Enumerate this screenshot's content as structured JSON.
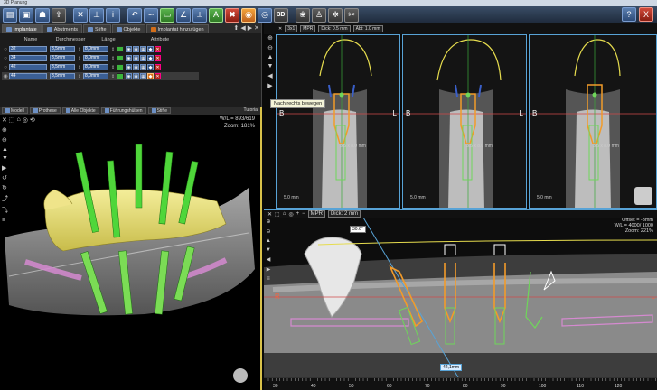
{
  "window": {
    "title": "3D Planung"
  },
  "toolbar": {
    "help": "?",
    "close": "X"
  },
  "left_panel": {
    "tabs": [
      {
        "label": "Implantate"
      },
      {
        "label": "Abutments"
      },
      {
        "label": "Stifte"
      },
      {
        "label": "Objekte"
      },
      {
        "label": "Implantat hinzufügen"
      }
    ],
    "columns": [
      "Name",
      "Durchmesser",
      "Länge",
      "Attribute"
    ],
    "rows": [
      {
        "name": "32",
        "diameter": "3,5mm",
        "length": "8,0mm",
        "color": "#3cb53c",
        "selected": false
      },
      {
        "name": "34",
        "diameter": "3,5mm",
        "length": "8,0mm",
        "color": "#3cb53c",
        "selected": false
      },
      {
        "name": "42",
        "diameter": "3,5mm",
        "length": "8,0mm",
        "color": "#3cb53c",
        "selected": false
      },
      {
        "name": "44",
        "diameter": "3,5mm",
        "length": "8,0mm",
        "color": "#3cb53c",
        "selected": true
      }
    ]
  },
  "panel3d": {
    "tabs": [
      {
        "label": "Modell"
      },
      {
        "label": "Prothese"
      },
      {
        "label": "Alle Objekte"
      },
      {
        "label": "Führungshülsen"
      },
      {
        "label": "Stifte"
      }
    ],
    "tutorial": "Tutorial",
    "wl": "W/L = 893/619",
    "zoom": "Zoom: 181%"
  },
  "slices": {
    "header_buttons": [
      "3x1",
      "MPR",
      "Dick: 0.5 mm",
      "Abt: 1.0 mm"
    ],
    "tooltip": "Nach rechts bewegen",
    "views": [
      {
        "left": "B",
        "right": "L",
        "scale": "5.0 mm",
        "measure": "3.5 x 8.0 mm"
      },
      {
        "left": "B",
        "right": "L",
        "scale": "5.0 mm",
        "measure": "3.5 x 8.0 mm"
      },
      {
        "left": "B",
        "right": "",
        "scale": "5.0 mm",
        "measure": "3.5 x 8.0 mm"
      }
    ]
  },
  "panorama": {
    "header_buttons": [
      "MPR",
      "Dick: 2 mm"
    ],
    "offset": "Offset = -3mm",
    "wl": "W/L = 4000/ 1000",
    "zoom": "Zoom: 221%",
    "label_top": "S",
    "label_left": "R",
    "label_right": "L",
    "angle": "30.6°",
    "length": "42,1mm",
    "ruler_ticks": [
      "30",
      "40",
      "50",
      "60",
      "70",
      "80",
      "90",
      "100",
      "110",
      "120"
    ]
  }
}
